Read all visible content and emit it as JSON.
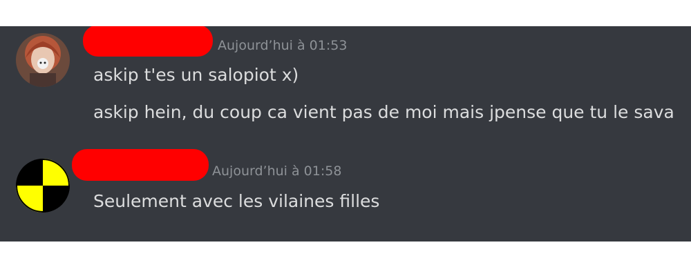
{
  "messages": [
    {
      "author_redacted": true,
      "timestamp": "Aujourd’hui à 01:53",
      "lines": [
        "askip t'es un salopiot x)",
        "askip hein, du coup ca vient pas de moi mais jpense que tu le sava"
      ]
    },
    {
      "author_redacted": true,
      "timestamp": "Aujourd’hui à 01:58",
      "lines": [
        "Seulement avec les vilaines filles"
      ]
    }
  ],
  "colors": {
    "background": "#36393f",
    "message_text": "#dcddde",
    "timestamp_text": "#8e9297",
    "redaction": "#ff0000",
    "crash_test_yellow": "#ffff00",
    "crash_test_black": "#000000"
  }
}
